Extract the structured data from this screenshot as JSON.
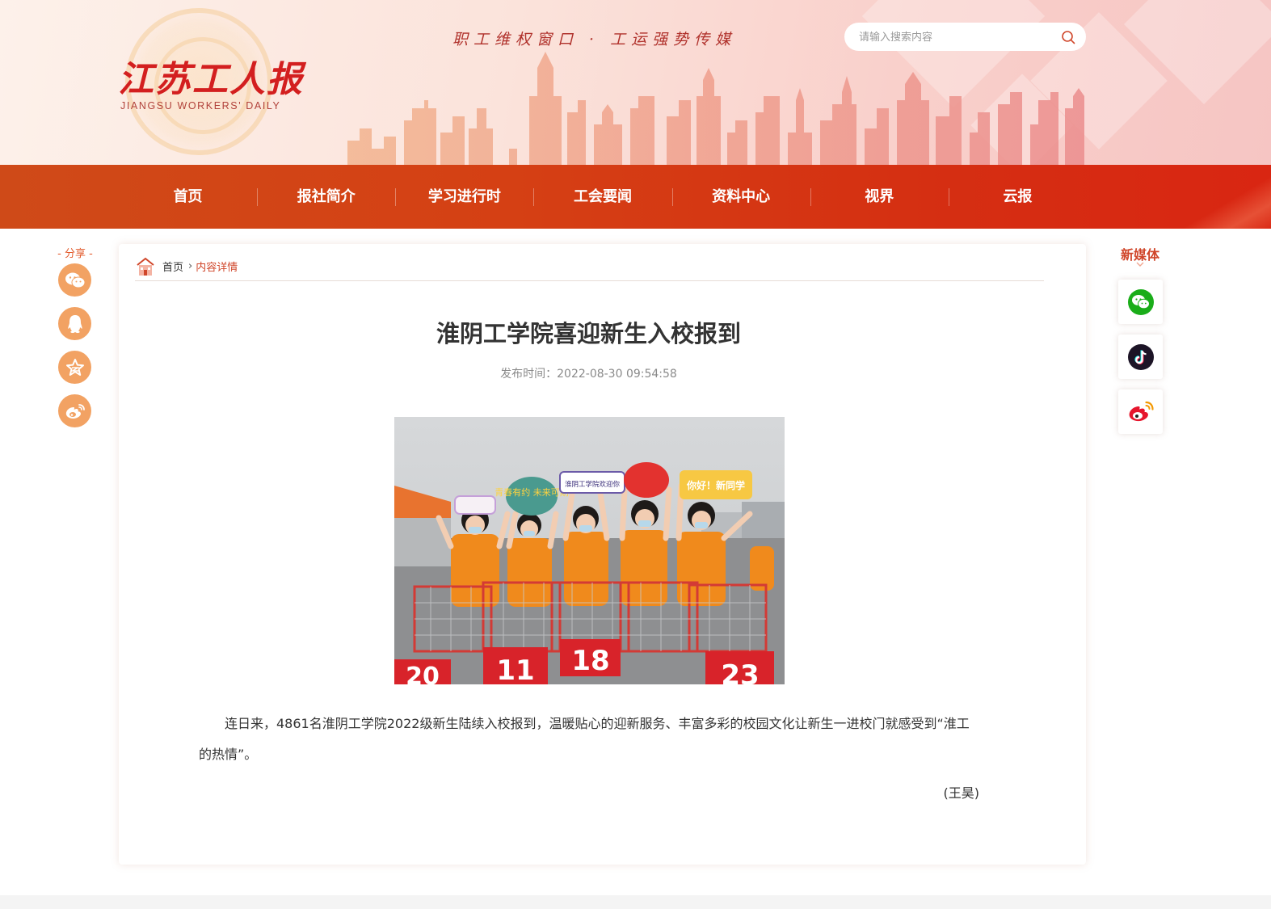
{
  "header": {
    "logo_cn": "江苏工人报",
    "logo_en": "JIANGSU WORKERS' DAILY",
    "slogan": "职工维权窗口 · 工运强势传媒",
    "search_placeholder": "请输入搜索内容"
  },
  "nav": {
    "items": [
      {
        "label": "首页"
      },
      {
        "label": "报社简介"
      },
      {
        "label": "学习进行时"
      },
      {
        "label": "工会要闻"
      },
      {
        "label": "资料中心"
      },
      {
        "label": "视界"
      },
      {
        "label": "云报"
      }
    ]
  },
  "share": {
    "title": "- 分享 -",
    "buttons": [
      "wechat-icon",
      "qq-icon",
      "qzone-icon",
      "weibo-icon"
    ],
    "color": "#f2a263"
  },
  "breadcrumb": {
    "home": "首页",
    "separator": "›",
    "current": "内容详情"
  },
  "article": {
    "title": "淮阴工学院喜迎新生入校报到",
    "publish_time": "发布时间：2022-08-30 09:54:58",
    "body": "连日来，4861名淮阴工学院2022级新生陆续入校报到，温暖贴心的迎新服务、丰富多彩的校园文化让新生一进校门就感受到“淮工的热情”。",
    "byline": "(王昊)",
    "photo": {
      "signs": [
        "青春有约 未来可期",
        "淮阴工学院欢迎你",
        "你好！新同学"
      ],
      "cart_numbers": [
        "20",
        "11",
        "18",
        "23"
      ]
    }
  },
  "new_media": {
    "title": "新媒体",
    "items": [
      "wechat-icon",
      "douyin-icon",
      "weibo-icon"
    ]
  },
  "colors": {
    "nav_bg": "#d54014",
    "accent": "#d0462a",
    "share_orange": "#f2a263"
  }
}
